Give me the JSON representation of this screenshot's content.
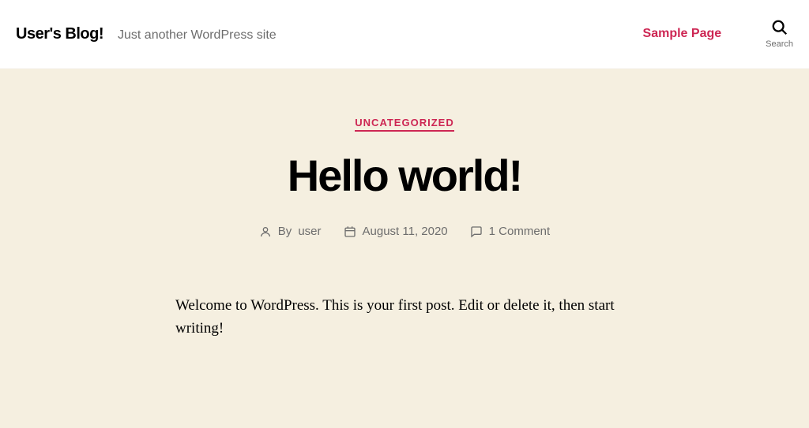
{
  "header": {
    "site_title": "User's Blog!",
    "tagline": "Just another WordPress site",
    "nav_link": "Sample Page",
    "search_label": "Search"
  },
  "post": {
    "category": "UNCATEGORIZED",
    "title": "Hello world!",
    "by_label": "By",
    "author": "user",
    "date": "August 11, 2020",
    "comments": "1 Comment",
    "body": "Welcome to WordPress. This is your first post. Edit or delete it, then start writing!"
  },
  "colors": {
    "accent": "#cd2653",
    "background": "#f5efe0"
  }
}
